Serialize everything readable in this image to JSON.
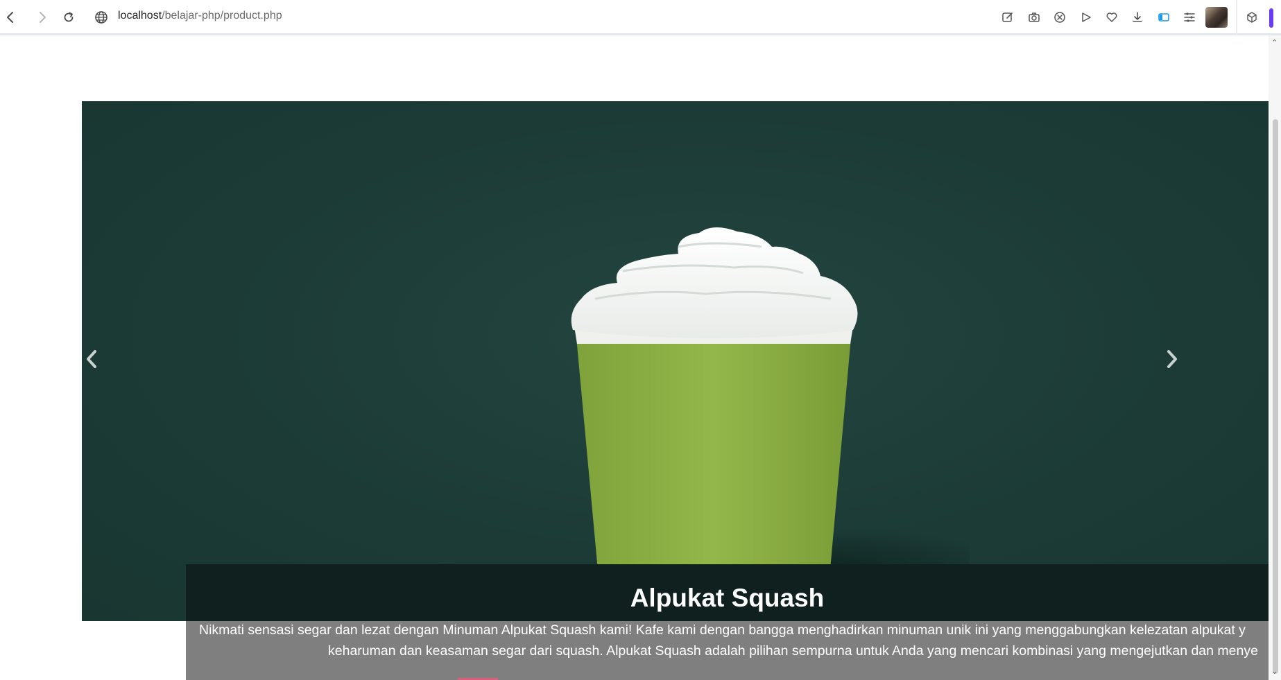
{
  "browser": {
    "url_host": "localhost",
    "url_path": "/belajar-php/product.php",
    "toolbar_icons": [
      "edit-icon",
      "camera-icon",
      "close-circle-icon",
      "play-icon",
      "heart-icon",
      "download-icon",
      "sidebar-toggle-icon",
      "sliders-icon",
      "profile-avatar",
      "cube-icon"
    ]
  },
  "carousel": {
    "slide_title": "Alpukat Squash",
    "slide_description_line1": "Nikmati sensasi segar dan lezat dengan Minuman Alpukat Squash kami! Kafe kami dengan bangga menghadirkan minuman unik ini yang menggabungkan kelezatan alpukat y",
    "slide_description_line2": "keharuman dan keasaman segar dari squash. Alpukat Squash adalah pilihan sempurna untuk Anda yang mencari kombinasi yang mengejutkan dan menye",
    "prev_icon": "chevron-left-icon",
    "next_icon": "chevron-right-icon",
    "background_color": "#1c3b37"
  },
  "colors": {
    "caption_dark": "#0f201e",
    "caption_gray": "#7f7f7f",
    "accent": "#6a3cf5"
  }
}
